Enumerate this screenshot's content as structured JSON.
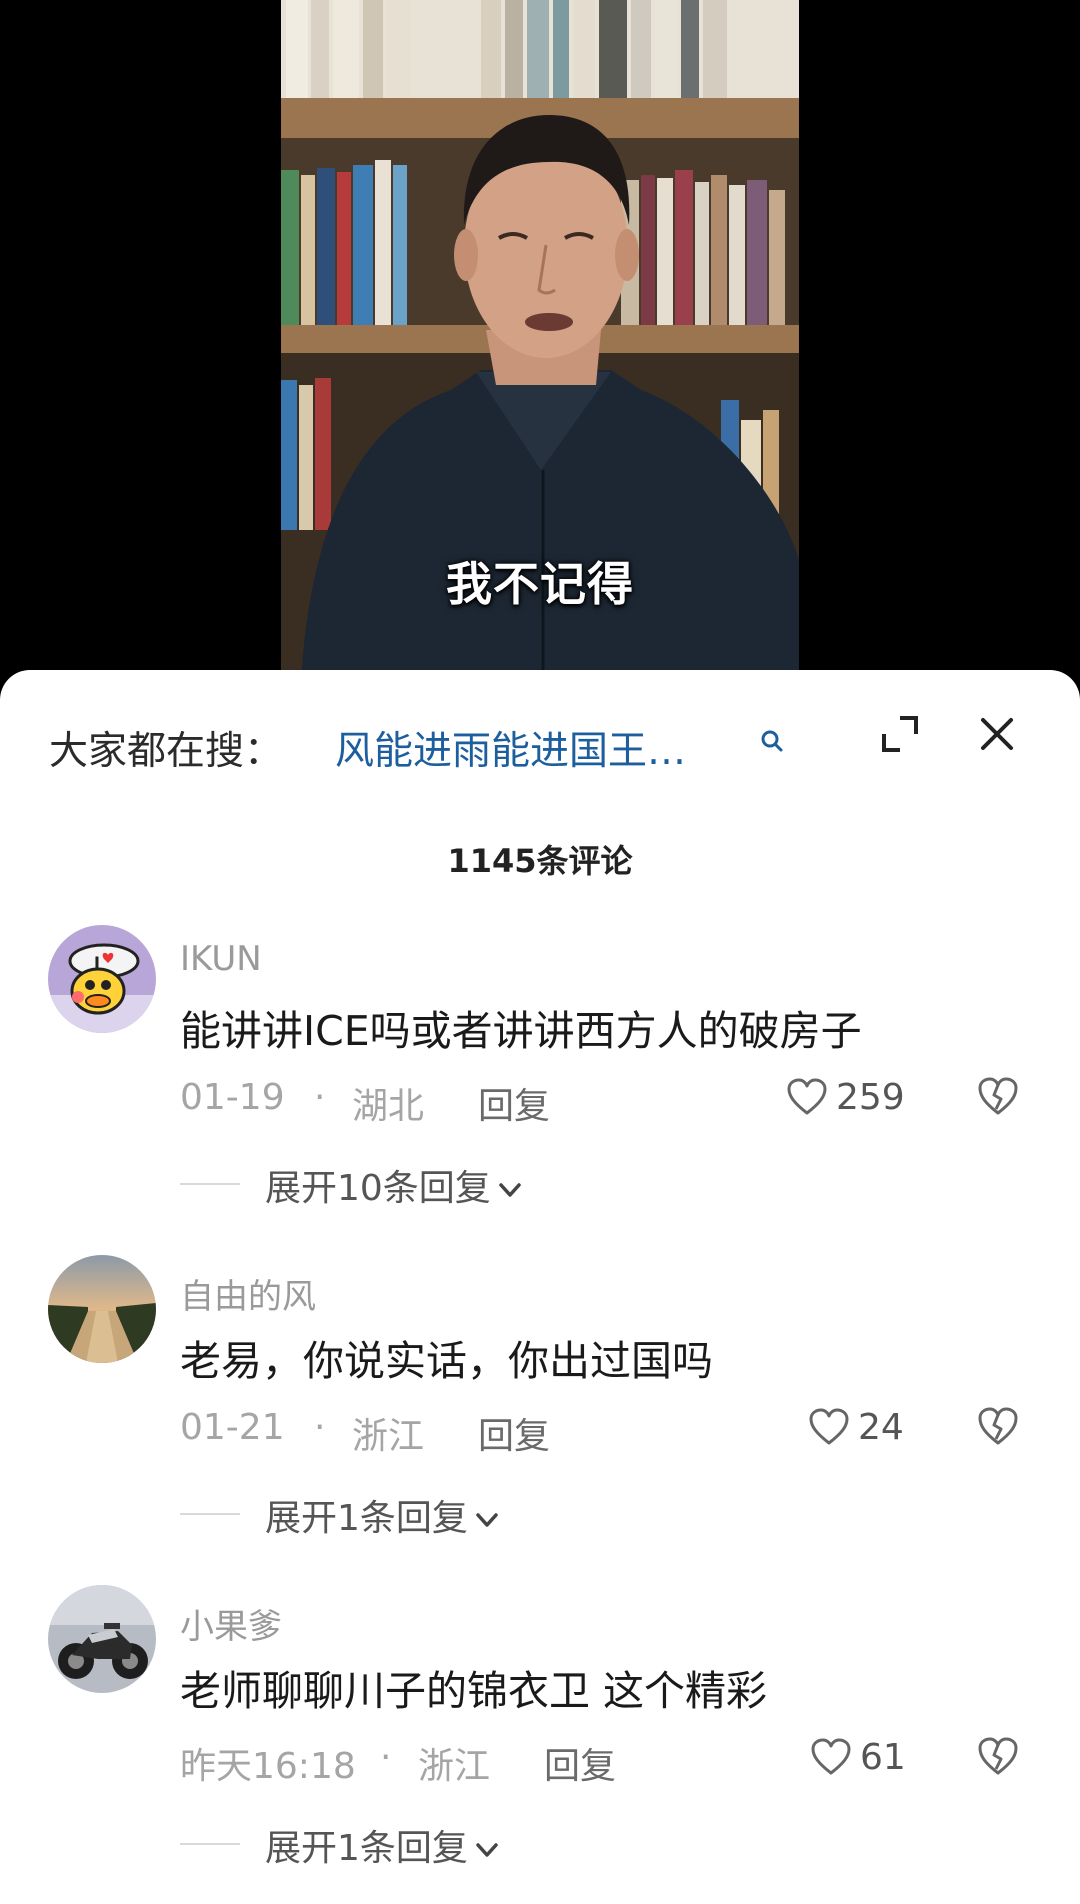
{
  "video": {
    "subtitle": "我不记得"
  },
  "search": {
    "prefix": "大家都在搜：",
    "query": "风能进雨能进国王…"
  },
  "comments_header": {
    "count_label": "1145条评论"
  },
  "comments": [
    {
      "username": "IKUN",
      "text": "能讲讲ICE吗或者讲讲西方人的破房子",
      "date": "01-19",
      "dot": "·",
      "region": "湖北",
      "reply_label": "回复",
      "likes": "259",
      "expand_label": "展开10条回复"
    },
    {
      "username": "自由的风",
      "text": "老易，你说实话，你出过国吗",
      "date": "01-21",
      "dot": "·",
      "region": "浙江",
      "reply_label": "回复",
      "likes": "24",
      "expand_label": "展开1条回复"
    },
    {
      "username": "小果爹",
      "text": "老师聊聊川子的锦衣卫 这个精彩",
      "date": "昨天16:18",
      "dot": "·",
      "region": "浙江",
      "reply_label": "回复",
      "likes": "61",
      "expand_label": "展开1条回复"
    }
  ],
  "colors": {
    "search_query": "#1d5e9e",
    "meta_gray": "#a5a5a5",
    "text_dark": "#1a1a1a"
  },
  "icons": {
    "search": "search-icon",
    "expand": "expand-icon",
    "close": "close-icon",
    "like": "heart-outline-icon",
    "dislike": "broken-heart-icon",
    "chevron": "chevron-down-icon"
  }
}
